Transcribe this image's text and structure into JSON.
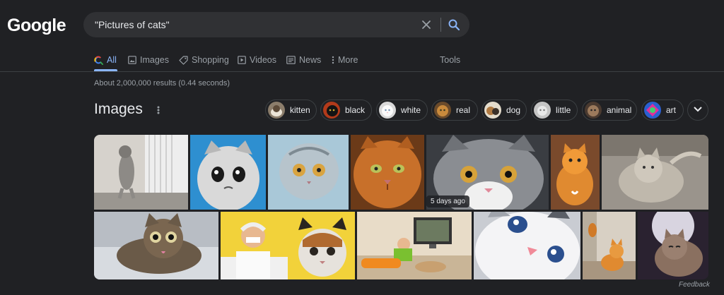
{
  "logo": {
    "text": "Google"
  },
  "search": {
    "query": "\"Pictures of cats\""
  },
  "tabs": [
    {
      "label": "All",
      "icon": "google-search-icon",
      "active": true
    },
    {
      "label": "Images",
      "icon": "image-icon"
    },
    {
      "label": "Shopping",
      "icon": "tag-icon"
    },
    {
      "label": "Videos",
      "icon": "play-icon"
    },
    {
      "label": "News",
      "icon": "news-icon"
    },
    {
      "label": "More",
      "icon": "kebab-icon"
    }
  ],
  "tools_label": "Tools",
  "result_stats": "About 2,000,000 results (0.44 seconds)",
  "images_section": {
    "title": "Images",
    "chips": [
      "kitten",
      "black",
      "white",
      "real",
      "dog",
      "little",
      "animal",
      "art"
    ]
  },
  "timestamp_badge": "5 days ago",
  "feedback": "Feedback",
  "colors": {
    "background": "#202124",
    "searchbox": "#303134",
    "accent": "#8ab4f8",
    "text_primary": "#e8eaed",
    "text_secondary": "#9aa0a6"
  }
}
